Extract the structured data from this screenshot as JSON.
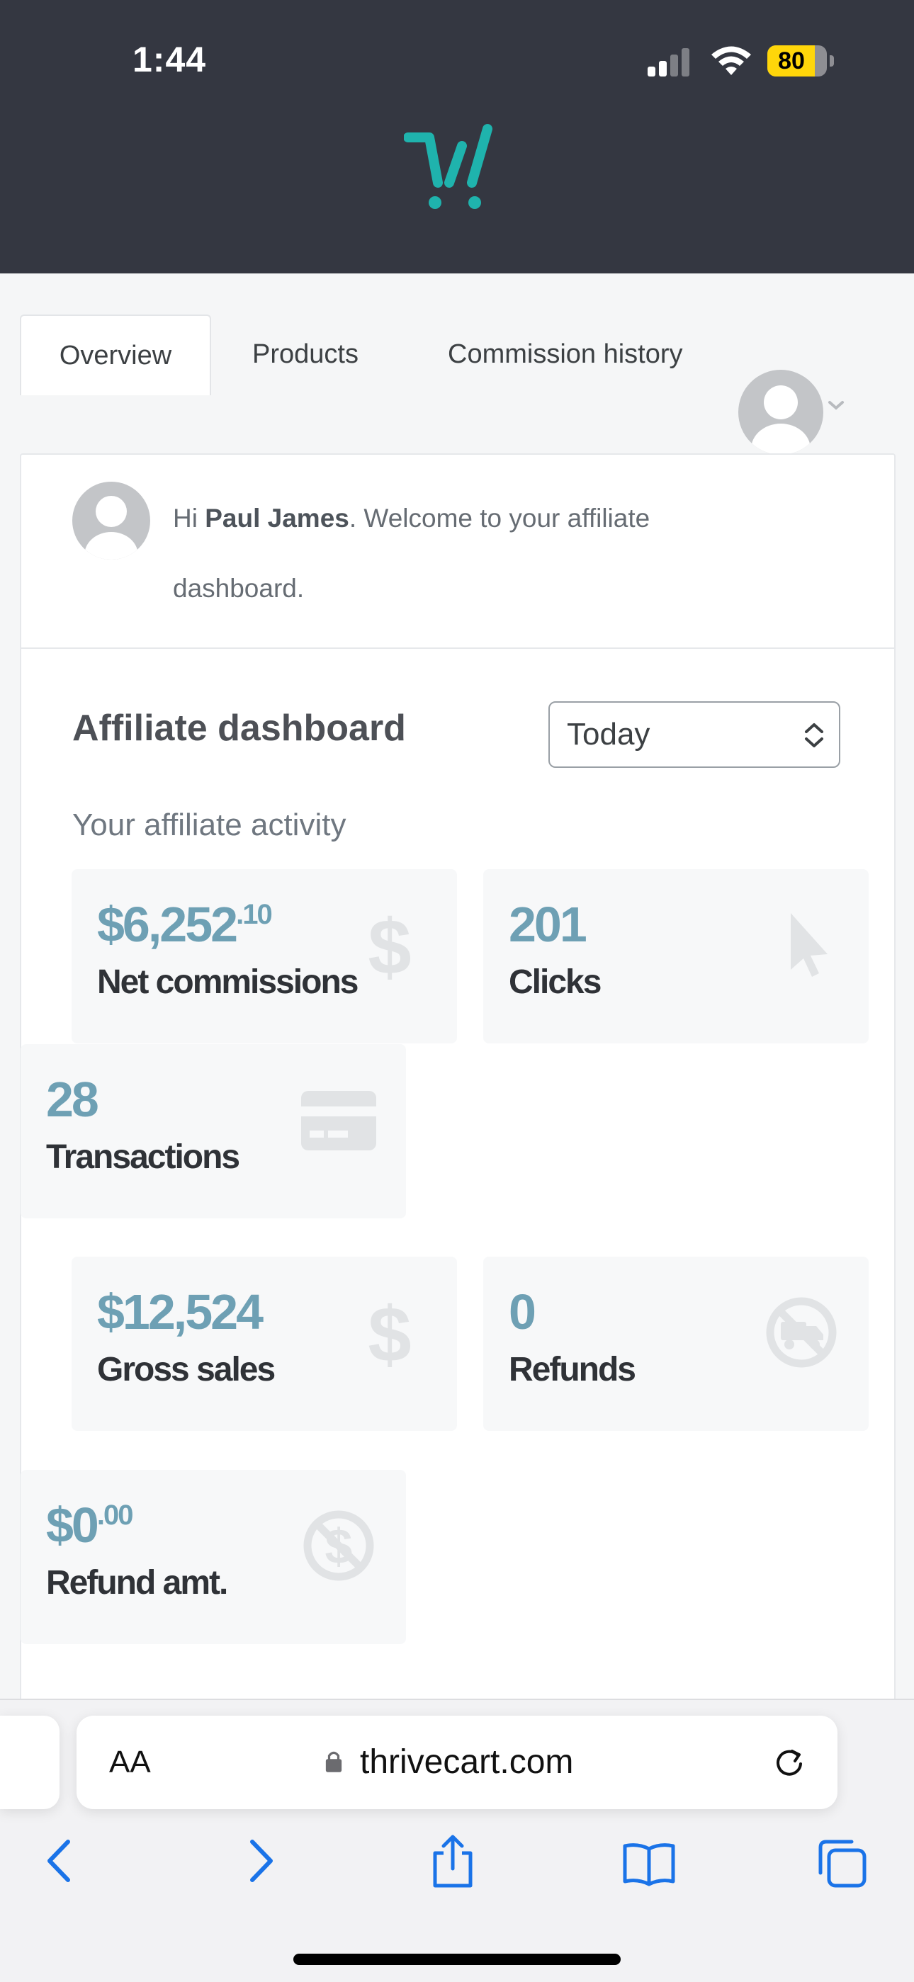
{
  "status_bar": {
    "time": "1:44",
    "battery": "80",
    "battery_level": 0.8
  },
  "tabs": [
    {
      "label": "Overview",
      "active": true
    },
    {
      "label": "Products",
      "active": false
    },
    {
      "label": "Commission history",
      "active": false
    }
  ],
  "welcome": {
    "prefix": "Hi ",
    "name": "Paul James",
    "suffix": ". Welcome to your affiliate dashboard."
  },
  "dashboard": {
    "title": "Affiliate dashboard",
    "period": "Today",
    "subtitle": "Your affiliate activity"
  },
  "stats": [
    {
      "value": "$6,252",
      "cents": ".10",
      "label": "Net commissions",
      "icon": "dollar-icon"
    },
    {
      "value": "201",
      "cents": "",
      "label": "Clicks",
      "icon": "cursor-icon"
    },
    {
      "value": "28",
      "cents": "",
      "label": "Transactions",
      "icon": "credit-card-icon"
    },
    {
      "value": "$12,524",
      "cents": "",
      "label": "Gross sales",
      "icon": "dollar-icon"
    },
    {
      "value": "0",
      "cents": "",
      "label": "Refunds",
      "icon": "no-delivery-icon"
    },
    {
      "value": "$0",
      "cents": ".00",
      "label": "Refund amt.",
      "icon": "no-dollar-icon"
    }
  ],
  "browser": {
    "text_size_label": "AA",
    "url": "thrivecart.com"
  },
  "colors": {
    "header_bg": "#343741",
    "brand_teal": "#1fb3ad",
    "stat_value": "#6ea0b4",
    "ios_blue": "#1a73e8"
  }
}
